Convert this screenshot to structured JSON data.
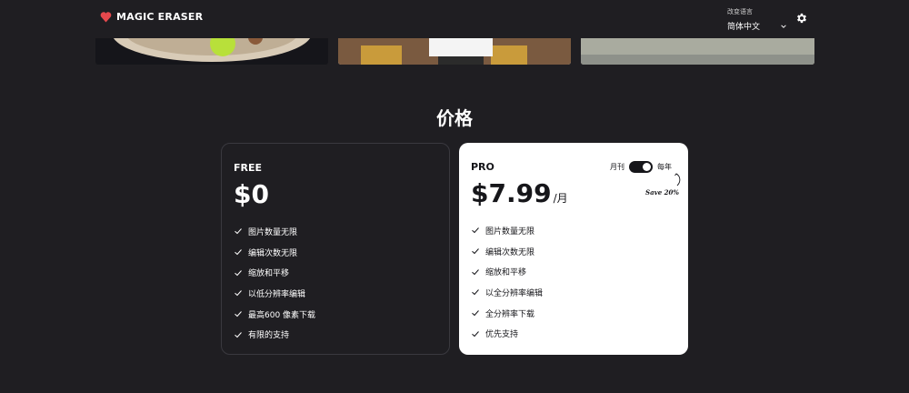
{
  "brand": {
    "name": "MAGIC ERASER",
    "logo_color": "#e5484d"
  },
  "language": {
    "label": "改变语言",
    "selected": "简体中文"
  },
  "icons": {
    "settings": "gear-icon",
    "dropdown": "chevron-down-icon",
    "check": "check-icon"
  },
  "pricing": {
    "title": "价格",
    "free": {
      "name": "FREE",
      "price": "$0",
      "features": [
        "图片数量无限",
        "编辑次数无限",
        "缩放和平移",
        "以低分辨率编辑",
        "最高600 像素下载",
        "有限的支持"
      ]
    },
    "pro": {
      "name": "PRO",
      "price": "$7.99",
      "per": "/月",
      "billing": {
        "monthly": "月刊",
        "yearly": "每年",
        "yearly_selected": true
      },
      "save_note": "Save 20%",
      "features": [
        "图片数量无限",
        "编辑次数无限",
        "缩放和平移",
        "以全分辨率编辑",
        "全分辨率下载",
        "优先支持"
      ]
    }
  }
}
